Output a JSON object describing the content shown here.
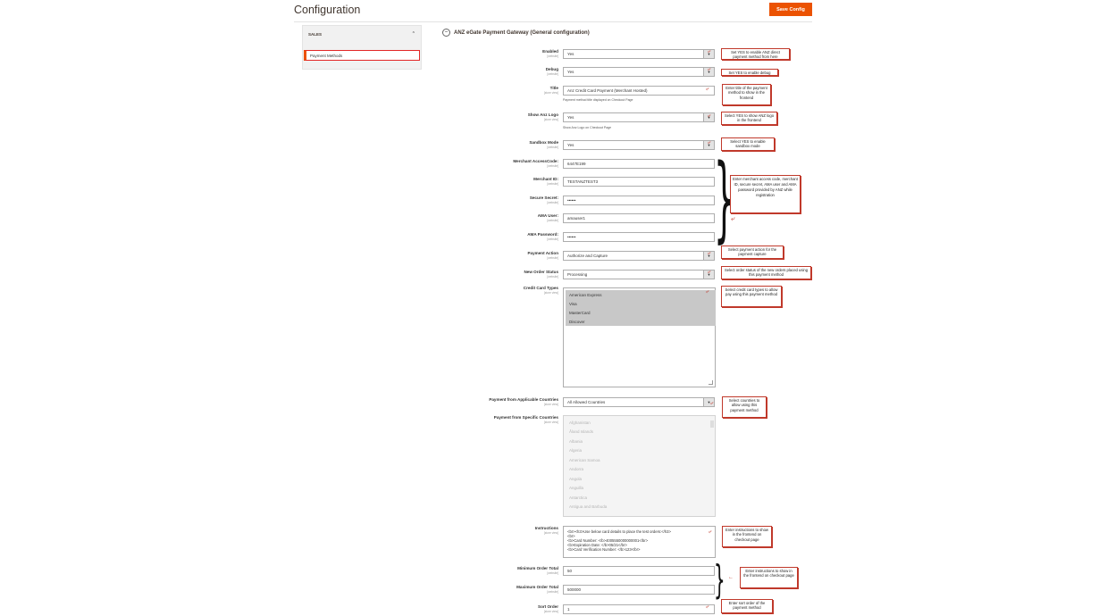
{
  "header": {
    "title": "Configuration",
    "save_label": "Save Config"
  },
  "sidebar": {
    "section": "SALES",
    "item": "Payment Methods"
  },
  "section": {
    "title": "ANZ eGate Payment Gateway (General configuration)"
  },
  "fields": {
    "enabled": {
      "label": "Enabled",
      "scope": "[website]",
      "value": "Yes"
    },
    "debug": {
      "label": "Debug",
      "scope": "[website]",
      "value": "Yes"
    },
    "title": {
      "label": "Title",
      "scope": "[store view]",
      "value": "Anz Credit Card Payment (Merchant Hosted)",
      "note": "Payment method title displayed on Checkout Page"
    },
    "show_logo": {
      "label": "Show Anz Logo",
      "scope": "[store view]",
      "value": "Yes",
      "note": "Show Anz Logo on Checkout Page"
    },
    "sandbox": {
      "label": "Sandbox Mode",
      "scope": "[website]",
      "value": "Yes"
    },
    "access_code": {
      "label": "Merchant AccessCode:",
      "scope": "[website]",
      "value": "6447E199"
    },
    "merchant_id": {
      "label": "Merchant ID:",
      "scope": "[website]",
      "value": "TESTANZTEST3"
    },
    "secure_secret": {
      "label": "Secure Secret:",
      "scope": "[website]",
      "value": "••••••"
    },
    "ama_user": {
      "label": "AMA User:",
      "scope": "[website]",
      "value": "amauser1"
    },
    "ama_password": {
      "label": "AMA Password:",
      "scope": "[website]",
      "value": "••••••"
    },
    "payment_action": {
      "label": "Payment Action",
      "scope": "[website]",
      "value": "Authorize and Capture"
    },
    "order_status": {
      "label": "New Order Status",
      "scope": "[website]",
      "value": "Processing"
    },
    "cc_types": {
      "label": "Credit Card Types",
      "scope": "[store view]",
      "options": [
        "American Express",
        "Visa",
        "MasterCard",
        "Discover"
      ]
    },
    "applicable_countries": {
      "label": "Payment from Applicable Countries",
      "scope": "[store view]",
      "value": "All Allowed Countries"
    },
    "specific_countries": {
      "label": "Payment from Specific Countries",
      "scope": "[store view]",
      "options": [
        "Afghanistan",
        "Åland Islands",
        "Albania",
        "Algeria",
        "American Samoa",
        "Andorra",
        "Angola",
        "Anguilla",
        "Antarctica",
        "Antigua and Barbuda"
      ]
    },
    "instructions": {
      "label": "Instructions",
      "scope": "[store view]",
      "value": "<br><h3>Use below card details to place the test orders:</h3>\n<br>\n<b>Card Number: </b>4005550000000001</br>\n<b>Expiration Date: </b>05/21</br>\n<b>Card Verification Number: </b>123</br>"
    },
    "min_total": {
      "label": "Minimum Order Total",
      "scope": "[website]",
      "value": "50"
    },
    "max_total": {
      "label": "Maximum Order Total",
      "scope": "[website]",
      "value": "500000"
    },
    "sort_order": {
      "label": "Sort Order",
      "scope": "[store view]",
      "value": "1"
    }
  },
  "callouts": {
    "enabled": "Set YES to enable ANZ direct payment method from here",
    "debug": "Set YES to enable debug",
    "title": "Enter title of the payment method to show in the frontend",
    "logo": "Select YES to show ANZ logo in the frontend",
    "sandbox": "Select YES to enable sandbox mode",
    "credentials": "Enter merchant access code, merchant ID, secure secret, AMA user and AMA password provided by ANZ while registration",
    "action": "Select payment action for the payment capture",
    "status": "Select order status of the new orders placed using this payment method",
    "cc": "Select credit card types to allow pay using this payment method",
    "countries": "Select countries to allow using this payment method",
    "instructions": "Enter instructions to show in the frontend on checkout page",
    "totals": "Enter instructions to show in the frontend on checkout page",
    "sort": "Enter sort order of the payment method"
  }
}
